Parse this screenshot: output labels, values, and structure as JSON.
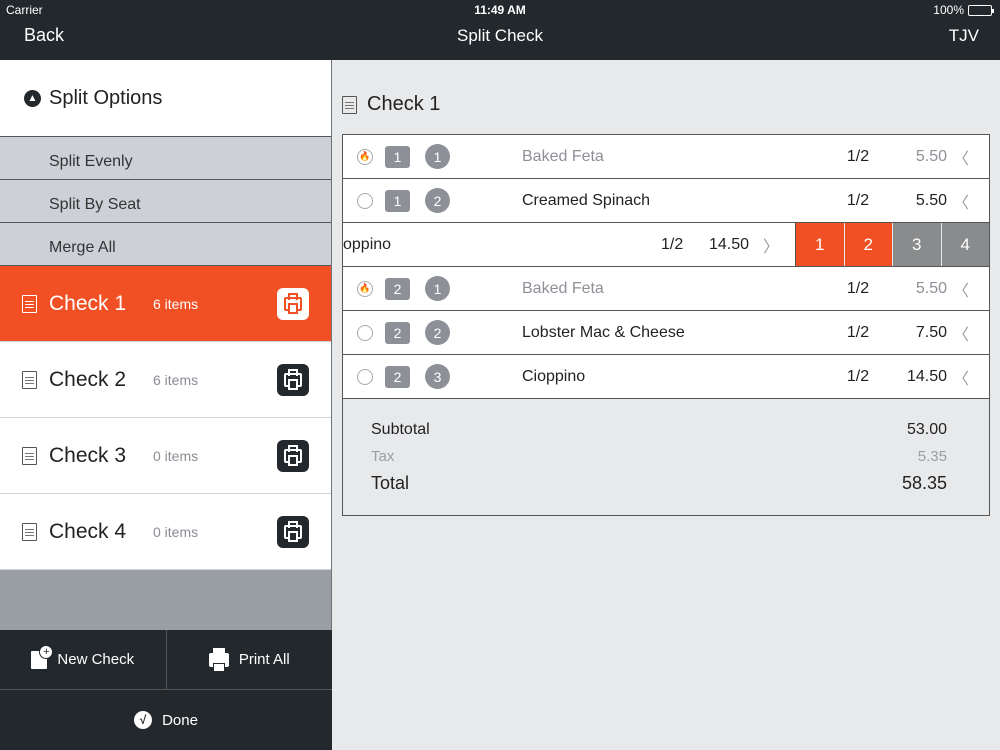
{
  "status_bar": {
    "carrier": "Carrier",
    "time": "11:49 AM",
    "battery": "100%"
  },
  "nav": {
    "back": "Back",
    "title": "Split Check",
    "right": "TJV"
  },
  "split_options": {
    "title": "Split Options",
    "items": [
      "Split Evenly",
      "Split By Seat",
      "Merge All"
    ]
  },
  "checks": [
    {
      "name": "Check 1",
      "count": "6 items",
      "active": true
    },
    {
      "name": "Check 2",
      "count": "6 items",
      "active": false
    },
    {
      "name": "Check 3",
      "count": "0 items",
      "active": false
    },
    {
      "name": "Check 4",
      "count": "0 items",
      "active": false
    }
  ],
  "actions": {
    "new_check": "New Check",
    "print_all": "Print All",
    "done": "Done"
  },
  "detail": {
    "title": "Check 1",
    "rows": [
      {
        "seat": "1",
        "course": "1",
        "name": "Baked Feta",
        "qty": "1/2",
        "price": "5.50",
        "fired": true
      },
      {
        "seat": "1",
        "course": "2",
        "name": "Creamed Spinach",
        "qty": "1/2",
        "price": "5.50",
        "fired": false
      },
      {
        "seat": "2",
        "course": "1",
        "name": "Baked Feta",
        "qty": "1/2",
        "price": "5.50",
        "fired": true
      },
      {
        "seat": "2",
        "course": "2",
        "name": "Lobster Mac & Cheese",
        "qty": "1/2",
        "price": "7.50",
        "fired": false
      },
      {
        "seat": "2",
        "course": "3",
        "name": "Cioppino",
        "qty": "1/2",
        "price": "14.50",
        "fired": false
      }
    ],
    "swiped_row": {
      "name": "oppino",
      "qty": "1/2",
      "price": "14.50",
      "seat_buttons": [
        "1",
        "2",
        "3",
        "4"
      ]
    },
    "subtotal_label": "Subtotal",
    "subtotal": "53.00",
    "tax_label": "Tax",
    "tax": "5.35",
    "total_label": "Total",
    "total": "58.35"
  },
  "colors": {
    "accent": "#f05024",
    "dark": "#23282d",
    "badge": "#8d9097"
  }
}
